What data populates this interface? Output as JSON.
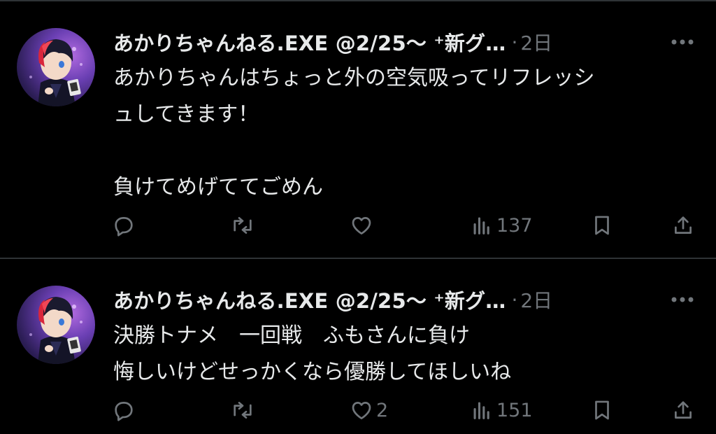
{
  "colors": {
    "background": "#000000",
    "text_primary": "#e7e9ea",
    "text_secondary": "#71767b",
    "divider": "#2f3336"
  },
  "tweets": [
    {
      "display_name": "あかりちゃんねる.EXE @2/25〜 ⁺新グ…",
      "separator": "·",
      "time": "2日",
      "text": "あかりちゃんはちょっと外の空気吸ってリフレッシ\nュしてきます！\n\n負けてめげててごめん",
      "actions": {
        "reply_icon": "reply-icon",
        "retweet_icon": "retweet-icon",
        "like_icon": "heart-icon",
        "like_count": "",
        "views_icon": "views-icon",
        "views_count": "137",
        "bookmark_icon": "bookmark-icon",
        "share_icon": "share-icon"
      }
    },
    {
      "display_name": "あかりちゃんねる.EXE @2/25〜 ⁺新グ…",
      "separator": "·",
      "time": "2日",
      "text": "決勝トナメ　一回戦　ふもさんに負け\n悔しいけどせっかくなら優勝してほしいね",
      "actions": {
        "reply_icon": "reply-icon",
        "retweet_icon": "retweet-icon",
        "like_icon": "heart-icon",
        "like_count": "2",
        "views_icon": "views-icon",
        "views_count": "151",
        "bookmark_icon": "bookmark-icon",
        "share_icon": "share-icon"
      }
    }
  ]
}
